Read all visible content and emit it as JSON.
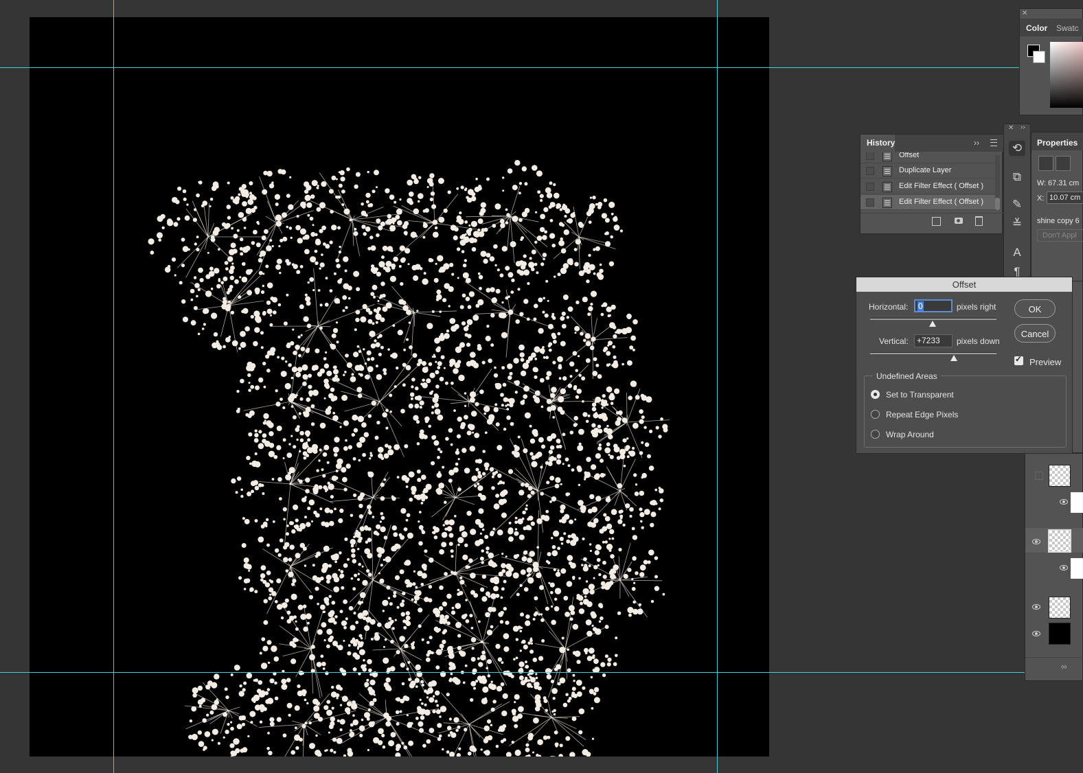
{
  "history_panel": {
    "tab": "History",
    "items": [
      {
        "label": "Offset",
        "active": false
      },
      {
        "label": "Duplicate Layer",
        "active": false
      },
      {
        "label": "Edit Filter Effect ( Offset )",
        "active": false
      },
      {
        "label": "Edit Filter Effect ( Offset )",
        "active": true
      }
    ]
  },
  "color_panel": {
    "tabs": [
      "Color",
      "Swatc"
    ]
  },
  "properties_panel": {
    "tab": "Properties",
    "w_label": "W:",
    "w_value": "67.31 cm",
    "x_label": "X:",
    "x_value": "10.07 cm",
    "layer_name": "shine copy 6",
    "dont_apply": "Don't Appl"
  },
  "offset_dialog": {
    "title": "Offset",
    "horizontal_label": "Horizontal:",
    "horizontal_value": "0",
    "horizontal_unit": "pixels right",
    "vertical_label": "Vertical:",
    "vertical_value": "+7233",
    "vertical_unit": "pixels down",
    "ok": "OK",
    "cancel": "Cancel",
    "preview_label": "Preview",
    "preview_checked": true,
    "group_label": "Undefined Areas",
    "options": [
      {
        "label": "Set to Transparent",
        "selected": true
      },
      {
        "label": "Repeat Edge Pixels",
        "selected": false
      },
      {
        "label": "Wrap Around",
        "selected": false
      }
    ]
  },
  "colors": {
    "background": "#353535",
    "canvas": "#000000",
    "guide": "#46d0d6",
    "flower": "#f3ece4",
    "panel": "#535353",
    "focus": "#5a8ed6"
  },
  "icons": [
    "expand-icon",
    "panel-menu-icon",
    "new-document-icon",
    "snapshot-icon",
    "trash-icon",
    "link-icon"
  ]
}
